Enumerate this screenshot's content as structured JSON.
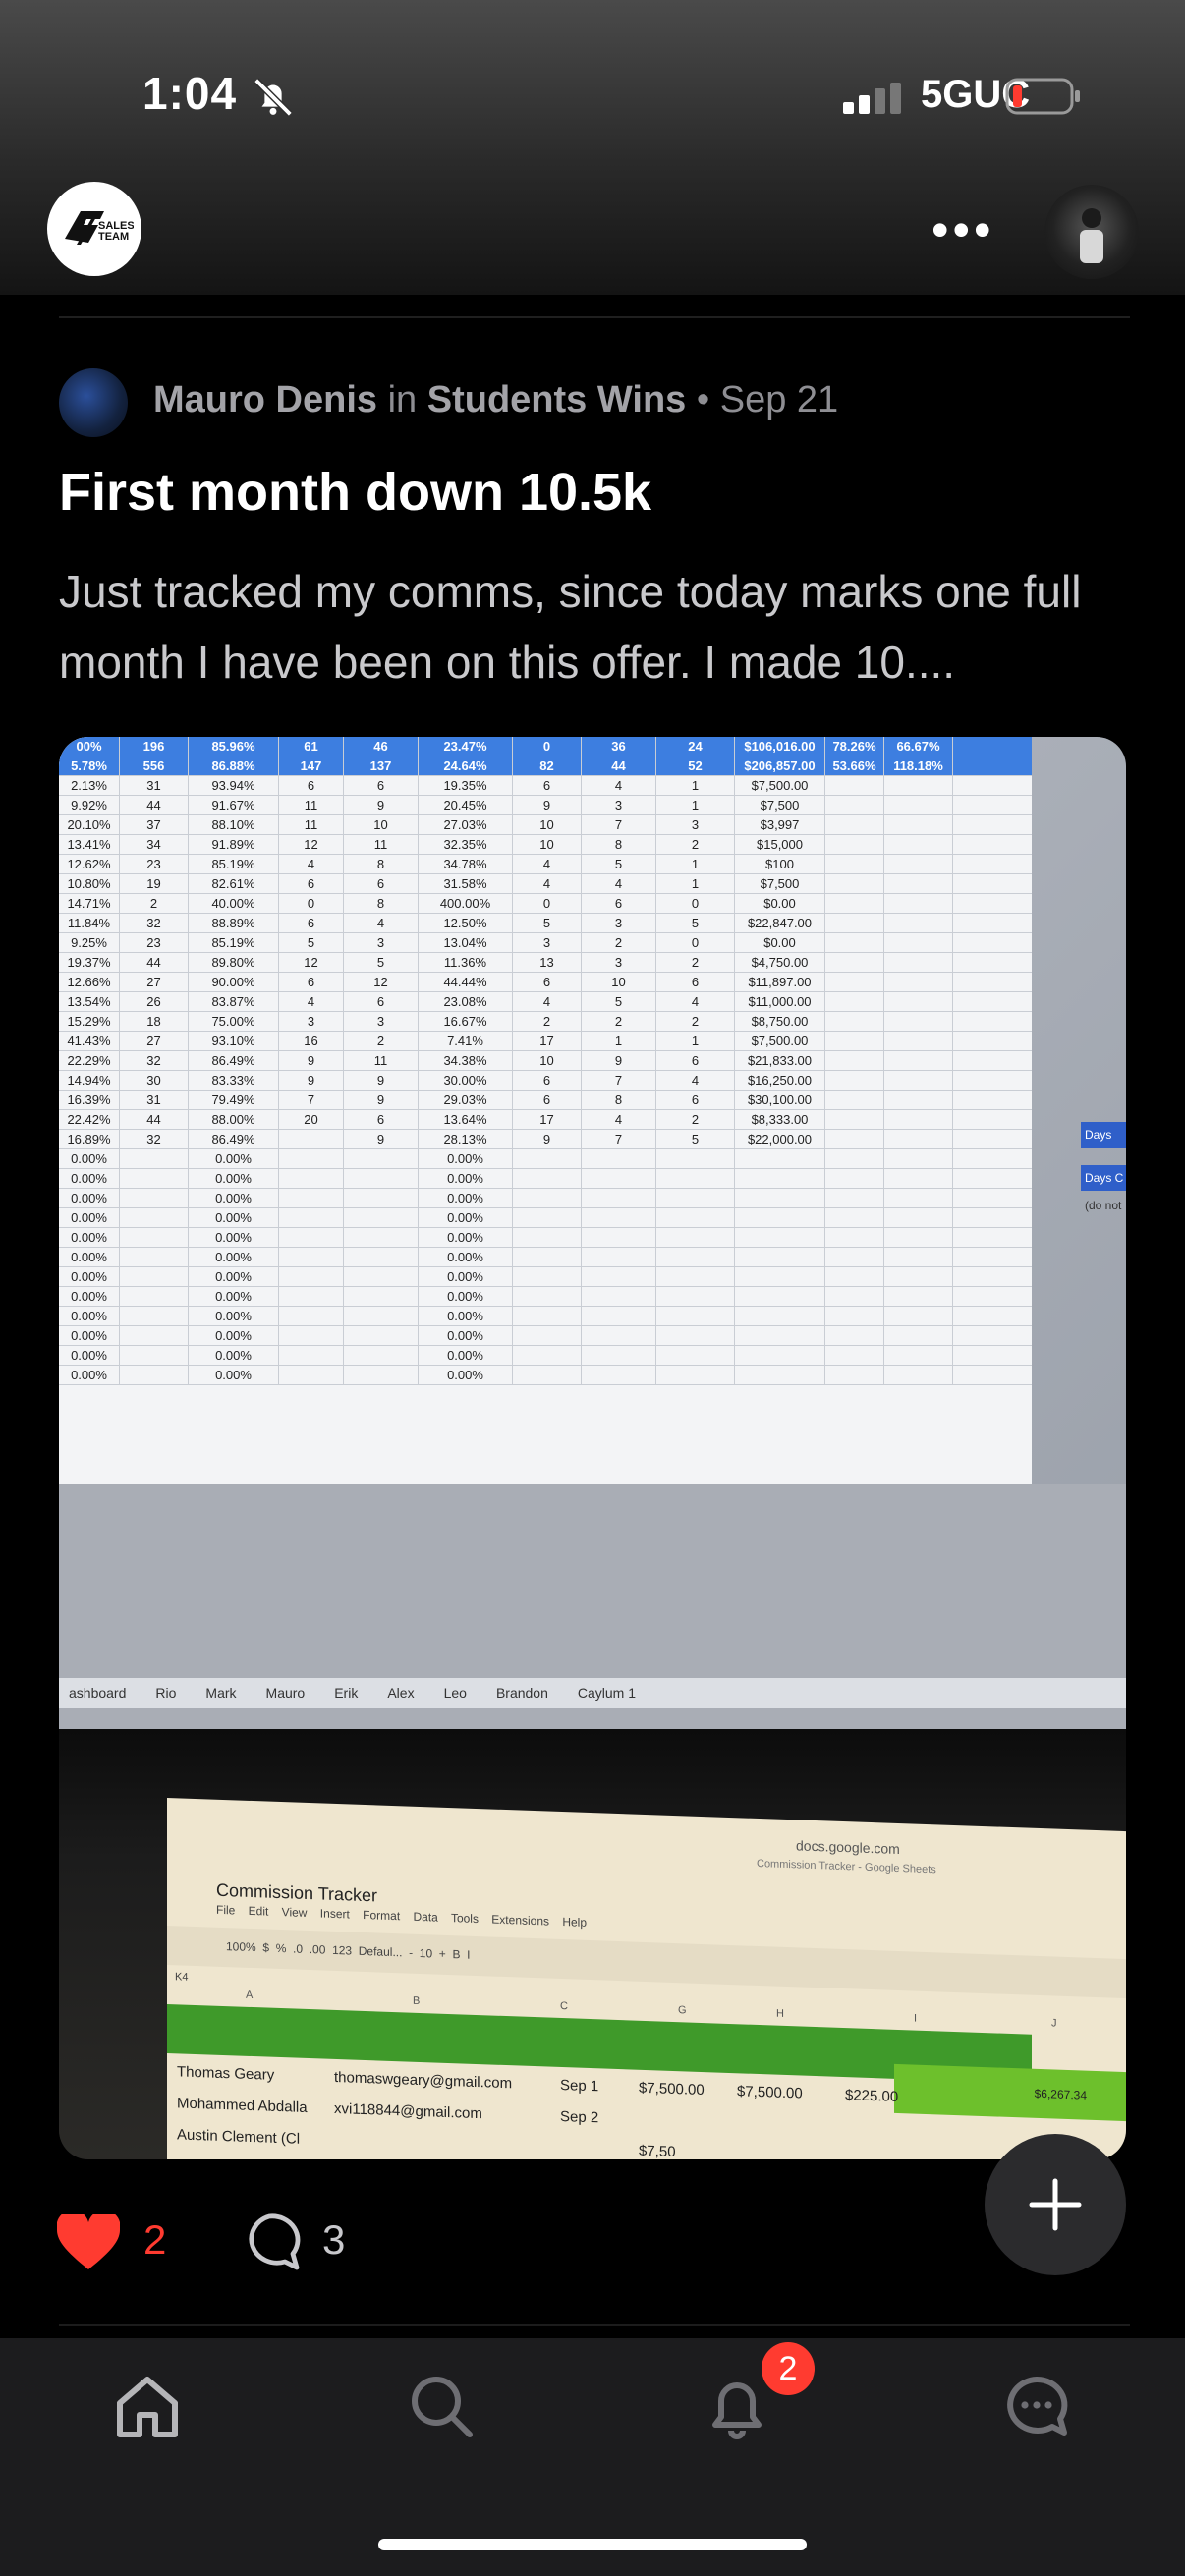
{
  "status_bar": {
    "time": "1:04",
    "network": "5GUC"
  },
  "header": {
    "logo_text": "SALES TEAM 6",
    "more_label": "•••"
  },
  "post": {
    "author": "Mauro Denis",
    "in_label": "in",
    "community": "Students Wins",
    "separator": "•",
    "date": "Sep 21",
    "title": "First month down 10.5k",
    "body": "Just tracked my comms, since today marks one full month I have been on this offer. I made 10...."
  },
  "photo": {
    "sheet_header_rows": [
      [
        "00%",
        "196",
        "85.96%",
        "61",
        "46",
        "23.47%",
        "0",
        "36",
        "24",
        "$106,016.00",
        "78.26%",
        "66.67%"
      ],
      [
        "5.78%",
        "556",
        "86.88%",
        "147",
        "137",
        "24.64%",
        "82",
        "44",
        "52",
        "$206,857.00",
        "53.66%",
        "118.18%"
      ]
    ],
    "sheet_rows": [
      [
        "2.13%",
        "31",
        "93.94%",
        "6",
        "6",
        "19.35%",
        "6",
        "4",
        "1",
        "$7,500.00"
      ],
      [
        "9.92%",
        "44",
        "91.67%",
        "11",
        "9",
        "20.45%",
        "9",
        "3",
        "1",
        "$7,500"
      ],
      [
        "20.10%",
        "37",
        "88.10%",
        "11",
        "10",
        "27.03%",
        "10",
        "7",
        "3",
        "$3,997"
      ],
      [
        "13.41%",
        "34",
        "91.89%",
        "12",
        "11",
        "32.35%",
        "10",
        "8",
        "2",
        "$15,000"
      ],
      [
        "12.62%",
        "23",
        "85.19%",
        "4",
        "8",
        "34.78%",
        "4",
        "5",
        "1",
        "$100"
      ],
      [
        "10.80%",
        "19",
        "82.61%",
        "6",
        "6",
        "31.58%",
        "4",
        "4",
        "1",
        "$7,500"
      ],
      [
        "14.71%",
        "2",
        "40.00%",
        "0",
        "8",
        "400.00%",
        "0",
        "6",
        "0",
        "$0.00"
      ],
      [
        "11.84%",
        "32",
        "88.89%",
        "6",
        "4",
        "12.50%",
        "5",
        "3",
        "5",
        "$22,847.00"
      ],
      [
        "9.25%",
        "23",
        "85.19%",
        "5",
        "3",
        "13.04%",
        "3",
        "2",
        "0",
        "$0.00"
      ],
      [
        "19.37%",
        "44",
        "89.80%",
        "12",
        "5",
        "11.36%",
        "13",
        "3",
        "2",
        "$4,750.00"
      ],
      [
        "12.66%",
        "27",
        "90.00%",
        "6",
        "12",
        "44.44%",
        "6",
        "10",
        "6",
        "$11,897.00"
      ],
      [
        "13.54%",
        "26",
        "83.87%",
        "4",
        "6",
        "23.08%",
        "4",
        "5",
        "4",
        "$11,000.00"
      ],
      [
        "15.29%",
        "18",
        "75.00%",
        "3",
        "3",
        "16.67%",
        "2",
        "2",
        "2",
        "$8,750.00"
      ],
      [
        "41.43%",
        "27",
        "93.10%",
        "16",
        "2",
        "7.41%",
        "17",
        "1",
        "1",
        "$7,500.00"
      ],
      [
        "22.29%",
        "32",
        "86.49%",
        "9",
        "11",
        "34.38%",
        "10",
        "9",
        "6",
        "$21,833.00"
      ],
      [
        "14.94%",
        "30",
        "83.33%",
        "9",
        "9",
        "30.00%",
        "6",
        "7",
        "4",
        "$16,250.00"
      ],
      [
        "16.39%",
        "31",
        "79.49%",
        "7",
        "9",
        "29.03%",
        "6",
        "8",
        "6",
        "$30,100.00"
      ],
      [
        "22.42%",
        "44",
        "88.00%",
        "20",
        "6",
        "13.64%",
        "17",
        "4",
        "2",
        "$8,333.00"
      ],
      [
        "16.89%",
        "32",
        "86.49%",
        "",
        "9",
        "28.13%",
        "9",
        "7",
        "5",
        "$22,000.00"
      ]
    ],
    "zero_rows_count_label": "0.00%",
    "side_labels": [
      "Days",
      "Days C",
      "(do not"
    ],
    "tabs": [
      "ashboard",
      "Rio",
      "Mark",
      "Mauro",
      "Erik",
      "Alex",
      "Leo",
      "Brandon",
      "Caylum 1"
    ],
    "laptop": {
      "url": "docs.google.com",
      "tab_title": "Commission Tracker - Google Sheets",
      "doc_title": "Commission Tracker",
      "menu": "File Edit View Insert Format Data Tools Extensions Help",
      "toolbar": "100%  $  %  .0  .00  123  Defaul...  -  10  +  B  I",
      "cell_ref": "K4",
      "col_headers": [
        "A",
        "B",
        "C",
        "G",
        "H",
        "I",
        "J"
      ],
      "green_value": "$6,267.34",
      "rows": [
        {
          "name": "Thomas Geary",
          "email": "thomaswgeary@gmail.com",
          "date": "Sep 1",
          "g": "$7,500.00",
          "h": "$7,500.00",
          "i": "$225.00"
        },
        {
          "name": "Mohammed Abdalla",
          "email": "xvi118844@gmail.com",
          "date": "Sep 2",
          "g": "",
          "h": "",
          "i": ""
        },
        {
          "name": "Austin Clement (Cl",
          "email": "",
          "date": "",
          "g": "$7,50",
          "h": "",
          "i": ""
        }
      ]
    }
  },
  "reactions": {
    "likes": "2",
    "comments": "3"
  },
  "nav": {
    "notification_badge": "2"
  },
  "colors": {
    "like_red": "#ff3b30",
    "sheet_blue": "#3d7ee0",
    "sheet_green": "#3f9a2a"
  }
}
